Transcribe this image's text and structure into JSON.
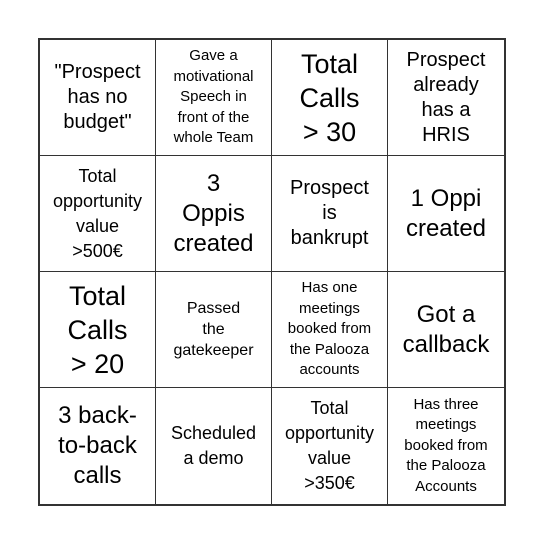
{
  "board": {
    "cells": [
      {
        "text": "\"Prospect\nhas no\nbudget\"",
        "size": "s-m"
      },
      {
        "text": "Gave a\nmotivational\nSpeech in\nfront of the\nwhole Team",
        "size": "s-xs"
      },
      {
        "text": "Total\nCalls\n> 30",
        "size": "s-xl"
      },
      {
        "text": "Prospect\nalready\nhas a\nHRIS",
        "size": "s-m"
      },
      {
        "text": "Total\nopportunity\nvalue\n>500€",
        "size": "s-sm"
      },
      {
        "text": "3\nOppis\ncreated",
        "size": "s-l"
      },
      {
        "text": "Prospect\nis\nbankrupt",
        "size": "s-m"
      },
      {
        "text": "1 Oppi\ncreated",
        "size": "s-l"
      },
      {
        "text": "Total\nCalls\n> 20",
        "size": "s-xl"
      },
      {
        "text": "Passed\nthe\ngatekeeper",
        "size": "s-s"
      },
      {
        "text": "Has one\nmeetings\nbooked from\nthe Palooza\naccounts",
        "size": "s-xs"
      },
      {
        "text": "Got a\ncallback",
        "size": "s-l"
      },
      {
        "text": "3 back-\nto-back\ncalls",
        "size": "s-l"
      },
      {
        "text": "Scheduled\na demo",
        "size": "s-sm"
      },
      {
        "text": "Total\nopportunity\nvalue\n>350€",
        "size": "s-sm"
      },
      {
        "text": "Has three\nmeetings\nbooked from\nthe Palooza\nAccounts",
        "size": "s-xs"
      }
    ]
  }
}
